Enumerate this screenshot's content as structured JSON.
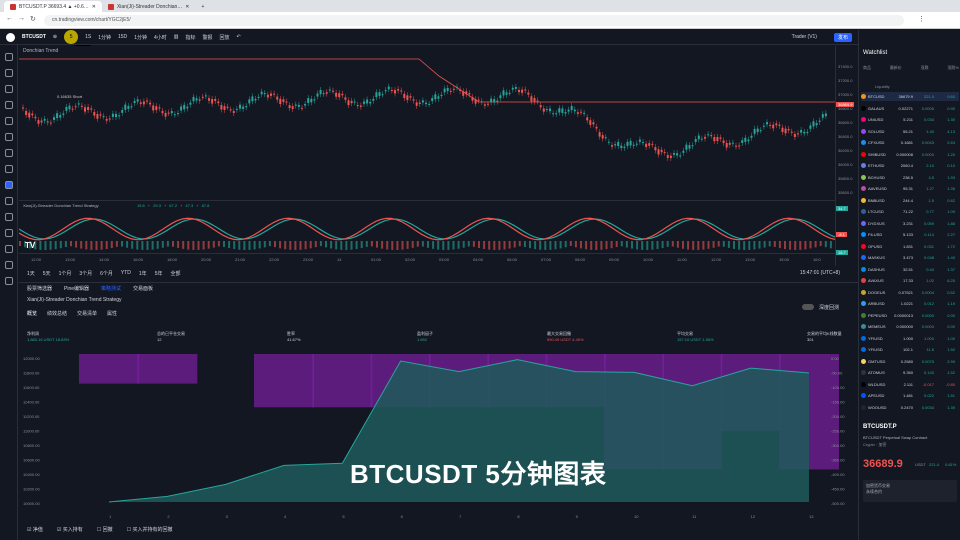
{
  "browser": {
    "tabs": [
      "BTCUSDT.P 36693.4 ▲ +0.6…",
      "Xian(Ji)-Streader Donchian…"
    ],
    "url": "cn.tradingview.com/chart/YGC2jE5/"
  },
  "toolbar": {
    "symbol": "BTCUSDT",
    "interval": "5",
    "items": [
      "1S",
      "1分钟",
      "15D",
      "1分钟",
      "4小时"
    ],
    "indicator_label": "指标",
    "alert": "警报",
    "replay": "回放",
    "tooltip": "5 分钟",
    "layout": "Trader (V1)",
    "publish": "发布"
  },
  "chart": {
    "main_legend": "Donchian Trend",
    "indicator_legend": "Xian(Ji)-Streader Donchian Trend Strategy",
    "signal": "0.16635 Short",
    "indicator_values": [
      "15.6",
      "+",
      "29.3",
      "+",
      "67.2",
      "+",
      "47.3",
      "+",
      "67.8"
    ]
  },
  "price_axis": [
    "37400.0",
    "37200.0",
    "37000.0",
    "36800.0",
    "36600.0",
    "36400.0",
    "36200.0",
    "36000.0",
    "35800.0",
    "35600.0"
  ],
  "price_badges": [
    {
      "text": "36869.9",
      "color": "#ef5350"
    },
    {
      "text": "34.7",
      "color": "#26a69a"
    },
    {
      "text": "-8.1",
      "color": "#ef5350"
    },
    {
      "text": "18.7",
      "color": "#26a69a"
    }
  ],
  "time_axis": [
    "12:00",
    "13:00",
    "14:00",
    "16:00",
    "18:00",
    "20:00",
    "21:00",
    "22:00",
    "23:00",
    "14",
    "01:00",
    "02:00",
    "03:00",
    "04:00",
    "06:00",
    "07:00",
    "08:00",
    "09:00",
    "10:00",
    "11:00",
    "12:00",
    "13:00",
    "15:00",
    "16:0"
  ],
  "range_buttons": [
    "1天",
    "5天",
    "1个月",
    "3个月",
    "6个月",
    "YTD",
    "1年",
    "5年",
    "全部"
  ],
  "range_right": "15:47:01 (UTC+8)",
  "bottom_tabs": [
    "股票筛选器",
    "Pine编辑器",
    "策略测试",
    "交易面板"
  ],
  "strategy": {
    "name": "Xian(Ji)-Streader Donchian Trend Strategy",
    "tabs": [
      "概览",
      "绩效总结",
      "交易清单",
      "属性"
    ],
    "deep_backtest": "深度回测",
    "metrics": [
      {
        "label": "净利润",
        "value": "1,883.16 USDT",
        "extra": "18.83%",
        "color": "#26a69a"
      },
      {
        "label": "总的已平仓交易",
        "value": "12",
        "extra": "",
        "color": "#d1d4dc"
      },
      {
        "label": "胜率",
        "value": "41.67%",
        "extra": "",
        "color": "#d1d4dc"
      },
      {
        "label": "盈利因子",
        "value": "1.692",
        "extra": "",
        "color": "#26a69a"
      },
      {
        "label": "最大交易回撤",
        "value": "590.49 USDT",
        "extra": "4.40%",
        "color": "#ef5350"
      },
      {
        "label": "平均交易",
        "value": "157.10 USDT",
        "extra": "1.56%",
        "color": "#26a69a"
      },
      {
        "label": "交易的平均K线数量",
        "value": "301",
        "extra": "",
        "color": "#d1d4dc"
      }
    ],
    "y_left": [
      "12000.00",
      "11800.00",
      "11600.00",
      "11400.00",
      "11200.00",
      "11000.00",
      "10800.00",
      "10600.00",
      "10400.00",
      "10200.00",
      "10000.00"
    ],
    "y_right": [
      "0.00",
      "-50.00",
      "-100.00",
      "-150.00",
      "-200.00",
      "-250.00",
      "-300.00",
      "-350.00",
      "-400.00",
      "-450.00",
      "-500.00"
    ],
    "x_labels": [
      "1",
      "2",
      "3",
      "4",
      "5",
      "6",
      "7",
      "8",
      "9",
      "10",
      "11",
      "12",
      "13"
    ],
    "legend": [
      "净值",
      "买入持有",
      "回撤",
      "买入并持有的回撤"
    ],
    "equity": [
      10000,
      10080,
      10250,
      10520,
      10550,
      12000,
      11850,
      12020,
      11850,
      11840,
      11650,
      11900,
      11830
    ],
    "drawdown": [
      -100,
      -100,
      0,
      -180,
      -180,
      -180,
      -180,
      -180,
      -180,
      -390,
      -390,
      -260,
      -390
    ]
  },
  "subtitle": "BTCUSDT 5分钟图表",
  "watchlist": {
    "title": "Watchlist",
    "headers": [
      "商品",
      "最新价",
      "涨跌",
      "涨跌%"
    ],
    "section": "Liquidity",
    "rows": [
      {
        "s": "BTCUSD",
        "p": "36679.9",
        "c": "221.0",
        "pc": "0.60",
        "u": true,
        "color": "#f7931a"
      },
      {
        "s": "GALAUS",
        "p": "0.02271",
        "c": "0.0005",
        "pc": "0.90",
        "u": true,
        "color": "#000000"
      },
      {
        "s": "UNIUSD",
        "p": "5.211",
        "c": "0.034",
        "pc": "1.30",
        "u": true,
        "color": "#ff007a"
      },
      {
        "s": "SOLUSD",
        "p": "55.21",
        "c": "1.40",
        "pc": "4.13",
        "u": true,
        "color": "#9945ff"
      },
      {
        "s": "CFXUSD",
        "p": "0.1681",
        "c": "0.0043",
        "pc": "2.63",
        "u": true,
        "color": "#1f8bf1"
      },
      {
        "s": "SHIBUSD",
        "p": "0.000008",
        "c": "0.0000",
        "pc": "1.20",
        "u": true,
        "color": "#f00500"
      },
      {
        "s": "ETHUSD",
        "p": "2060.4",
        "c": "2.10",
        "pc": "0.10",
        "u": true,
        "color": "#627eea"
      },
      {
        "s": "BCHUSD",
        "p": "238.5",
        "c": "4.5",
        "pc": "1.93",
        "u": true,
        "color": "#8dc351"
      },
      {
        "s": "AAVEUSD",
        "p": "95.31",
        "c": "1.27",
        "pc": "1.35",
        "u": true,
        "color": "#b6509e"
      },
      {
        "s": "BNBUSD",
        "p": "244.4",
        "c": "1.5",
        "pc": "0.62",
        "u": true,
        "color": "#f3ba2f"
      },
      {
        "s": "LTCUSD",
        "p": "71.22",
        "c": "0.77",
        "pc": "1.09",
        "u": true,
        "color": "#345d9d"
      },
      {
        "s": "DYDXUS",
        "p": "3.231",
        "c": "0.059",
        "pc": "1.86",
        "u": true,
        "color": "#6966ff"
      },
      {
        "s": "FILUSD",
        "p": "5.133",
        "c": "0.114",
        "pc": "2.27",
        "u": true,
        "color": "#0090ff"
      },
      {
        "s": "OPUSD",
        "p": "1.831",
        "c": "0.031",
        "pc": "1.72",
        "u": true,
        "color": "#ff0420"
      },
      {
        "s": "MASKUS",
        "p": "3.473",
        "c": "0.048",
        "pc": "1.40",
        "u": true,
        "color": "#1c68f3"
      },
      {
        "s": "DASHUS",
        "p": "32.51",
        "c": "0.44",
        "pc": "1.37",
        "u": true,
        "color": "#008ce7"
      },
      {
        "s": "AVAXUS",
        "p": "17.33",
        "c": "1.02",
        "pc": "6.25",
        "u": true,
        "color": "#e84142"
      },
      {
        "s": "DOGEUS",
        "p": "0.07521",
        "c": "0.0004",
        "pc": "0.52",
        "u": true,
        "color": "#c2a633"
      },
      {
        "s": "ARBUSD",
        "p": "1.0221",
        "c": "0.012",
        "pc": "1.19",
        "u": true,
        "color": "#28a0f0"
      },
      {
        "s": "PEPEUSD",
        "p": "0.0000013",
        "c": "0.0000",
        "pc": "0.00",
        "u": true,
        "color": "#3d8130"
      },
      {
        "s": "MEMEUS",
        "p": "0.000000",
        "c": "0.0000",
        "pc": "0.00",
        "u": true,
        "color": "#3e8a9b"
      },
      {
        "s": "YFIUSD",
        "p": "1.000",
        "c": "1.000",
        "pc": "1.00",
        "u": true,
        "color": "#006ae3"
      },
      {
        "s": "YFIUSD",
        "p": "102.1",
        "c": "11.6",
        "pc": "1.92",
        "u": true,
        "color": "#006ae3"
      },
      {
        "s": "GMTUSD",
        "p": "0.2580",
        "c": "0.0075",
        "pc": "2.99",
        "u": true,
        "color": "#f8d35c"
      },
      {
        "s": "ATOMUS",
        "p": "9.350",
        "c": "0.140",
        "pc": "1.52",
        "u": true,
        "color": "#2e3148"
      },
      {
        "s": "WLDUSD",
        "p": "2.111",
        "c": "-0.017",
        "pc": "-0.80",
        "u": false,
        "color": "#000000"
      },
      {
        "s": "APEUSD",
        "p": "1.481",
        "c": "0.022",
        "pc": "1.51",
        "u": true,
        "color": "#0054f9"
      },
      {
        "s": "WOOUSD",
        "p": "0.2470",
        "c": "0.0034",
        "pc": "1.39",
        "u": true,
        "color": "#20252f"
      }
    ],
    "detail_symbol": "BTCUSDT.P",
    "detail_name": "BTCUSDT Perpetual Swap Contract",
    "detail_exchange": "Crypto · 加密",
    "detail_price": "36689.9",
    "detail_unit": "USDT",
    "detail_change": "221.4",
    "detail_pct": "0.61%",
    "detail_notes": [
      "加密货币交易",
      "永续合约"
    ]
  }
}
